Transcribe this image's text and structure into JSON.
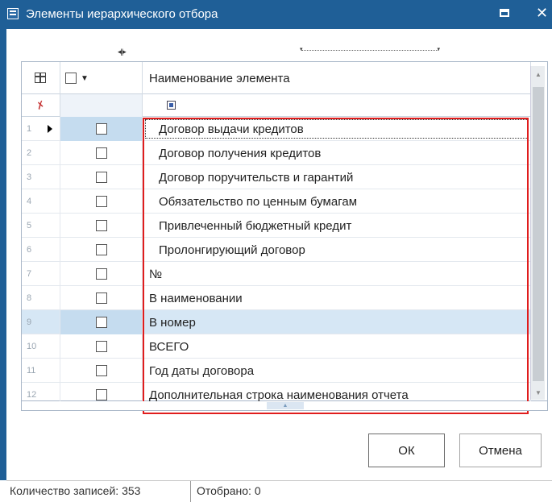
{
  "window": {
    "title": "Элементы иерархического отбора"
  },
  "grid": {
    "header_name": "Наименование элемента",
    "rows": [
      {
        "num": "1",
        "name": "Договор выдачи кредитов",
        "current": true
      },
      {
        "num": "2",
        "name": "Договор получения кредитов"
      },
      {
        "num": "3",
        "name": "Договор поручительств и гарантий"
      },
      {
        "num": "4",
        "name": "Обязательство по ценным бумагам"
      },
      {
        "num": "5",
        "name": "Привлеченный бюджетный кредит"
      },
      {
        "num": "6",
        "name": "Пролонгирующий договор"
      },
      {
        "num": "7",
        "name": "№"
      },
      {
        "num": "8",
        "name": "В наименовании"
      },
      {
        "num": "9",
        "name": "В номер",
        "highlighted": true
      },
      {
        "num": "10",
        "name": "ВСЕГО"
      },
      {
        "num": "11",
        "name": "Год даты договора"
      },
      {
        "num": "12",
        "name": "Дополнительная строка наименования отчета"
      }
    ]
  },
  "buttons": {
    "ok": "ОК",
    "cancel": "Отмена"
  },
  "status": {
    "records": "Количество записей: 353",
    "selected": "Отобрано: 0"
  },
  "icons": [
    "grid-icon",
    "checkbox-dropdown-icon",
    "pin-icon",
    "filter-icon",
    "row-pointer-icon",
    "window-icon",
    "maximize-icon",
    "close-icon"
  ]
}
